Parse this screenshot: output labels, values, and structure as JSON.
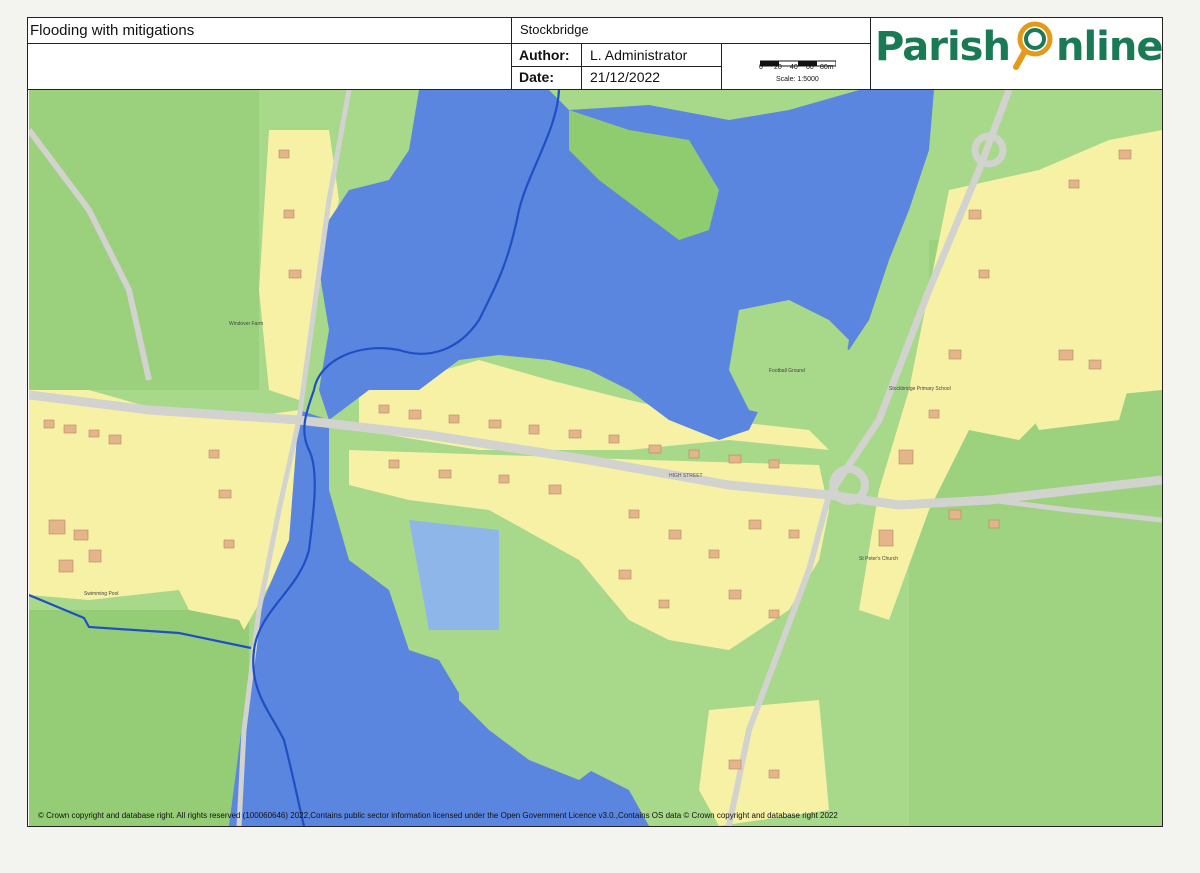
{
  "header": {
    "map_title": "Flooding with mitigations",
    "location": "Stockbridge",
    "author_label": "Author:",
    "author_value": "L. Administrator",
    "date_label": "Date:",
    "date_value": "21/12/2022",
    "scale_ticks": [
      "0",
      "20",
      "40",
      "60",
      "80m"
    ],
    "scale_text": "Scale: 1:5000",
    "logo_text_left": "Parish",
    "logo_text_right": "nline"
  },
  "footer": {
    "copyright": "© Crown copyright and database right. All rights reserved (100060646) 2022,Contains public sector information licensed under the Open Government Licence v3.0.,Contains OS data © Crown copyright and database right 2022"
  },
  "map_labels": {
    "high_street": "HIGH STREET",
    "football_ground": "Football Ground",
    "swimming_pool": "Swimming Pool",
    "school": "Stockbridge Primary School",
    "church": "St Peter's Church",
    "windover_farm": "Windover Farm"
  },
  "colors": {
    "flood": "#5b86e0",
    "flood_light": "#8fb6e8",
    "field": "#a8d88a",
    "field_dark": "#8fcc6f",
    "urban": "#f7f1a6",
    "road": "#d2d2cf",
    "river_line": "#1f4fc4",
    "building": "#e4b48a",
    "logo_green": "#1a7a55",
    "logo_orange": "#e39a1b"
  }
}
